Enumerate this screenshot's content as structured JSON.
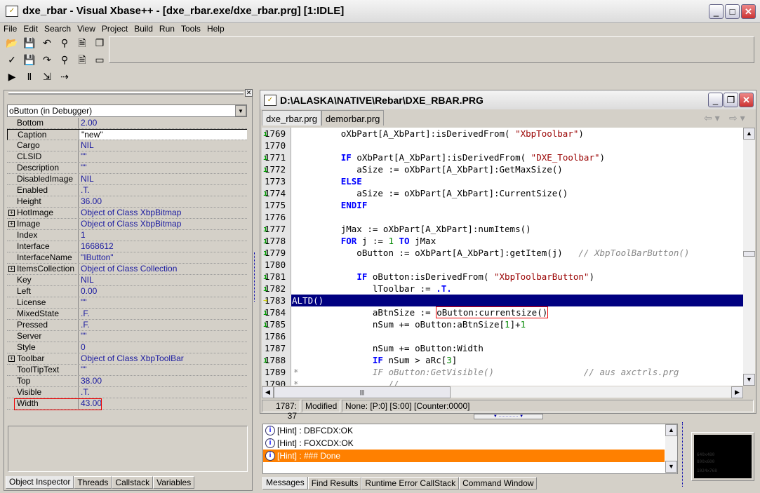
{
  "window": {
    "title": "dxe_rbar - Visual Xbase++ -  [dxe_rbar.exe/dxe_rbar.prg] [1:IDLE]",
    "controls": [
      "_",
      "□",
      "✕"
    ]
  },
  "menu": [
    "File",
    "Edit",
    "Search",
    "View",
    "Project",
    "Build",
    "Run",
    "Tools",
    "Help"
  ],
  "toolbar": {
    "rows": [
      [
        {
          "icon": "open-folder-icon",
          "glyph": "📂"
        },
        {
          "icon": "save-icon",
          "glyph": "💾"
        },
        {
          "icon": "undo-icon",
          "glyph": "↶"
        },
        {
          "icon": "find-icon",
          "glyph": "⚲"
        },
        {
          "icon": "new-file-icon",
          "glyph": "🗎"
        },
        {
          "icon": "windows-icon",
          "glyph": "❐"
        }
      ],
      [
        {
          "icon": "build-icon",
          "glyph": "✓"
        },
        {
          "icon": "save-all-icon",
          "glyph": "💾"
        },
        {
          "icon": "redo-icon",
          "glyph": "↷"
        },
        {
          "icon": "replace-icon",
          "glyph": "⚲"
        },
        {
          "icon": "close-file-icon",
          "glyph": "🗎"
        },
        {
          "icon": "output-window-icon",
          "glyph": "▭"
        }
      ],
      [
        {
          "icon": "run-stop-icon",
          "glyph": "▶"
        },
        {
          "icon": "pause-icon",
          "glyph": "Ⅱ"
        },
        {
          "icon": "step-into-icon",
          "glyph": "⇲"
        },
        {
          "icon": "step-over-icon",
          "glyph": "⇢"
        }
      ]
    ]
  },
  "inspector": {
    "object": "oButton (in Debugger)",
    "properties": [
      {
        "name": "Bottom",
        "value": "2.00"
      },
      {
        "name": "Caption",
        "value": "\"new\"",
        "selected": true
      },
      {
        "name": "Cargo",
        "value": "NIL"
      },
      {
        "name": "CLSID",
        "value": "\"\""
      },
      {
        "name": "Description",
        "value": "\"\""
      },
      {
        "name": "DisabledImage",
        "value": "NIL"
      },
      {
        "name": "Enabled",
        "value": ".T."
      },
      {
        "name": "Height",
        "value": "36.00"
      },
      {
        "name": "HotImage",
        "value": "Object of Class XbpBitmap",
        "expandable": true
      },
      {
        "name": "Image",
        "value": "Object of Class XbpBitmap",
        "expandable": true
      },
      {
        "name": "Index",
        "value": "1"
      },
      {
        "name": "Interface",
        "value": "1668612"
      },
      {
        "name": "InterfaceName",
        "value": "\"IButton\""
      },
      {
        "name": "ItemsCollection",
        "value": "Object of Class Collection",
        "expandable": true
      },
      {
        "name": "Key",
        "value": "NIL"
      },
      {
        "name": "Left",
        "value": "0.00"
      },
      {
        "name": "License",
        "value": "\"\""
      },
      {
        "name": "MixedState",
        "value": ".F."
      },
      {
        "name": "Pressed",
        "value": ".F."
      },
      {
        "name": "Server",
        "value": "\"\""
      },
      {
        "name": "Style",
        "value": "0"
      },
      {
        "name": "Toolbar",
        "value": "Object of Class XbpToolBar",
        "expandable": true
      },
      {
        "name": "ToolTipText",
        "value": "\"\""
      },
      {
        "name": "Top",
        "value": "38.00"
      },
      {
        "name": "Visible",
        "value": ".T."
      },
      {
        "name": "Width",
        "value": "43.00",
        "highlighted": true
      }
    ],
    "tabs": [
      "Object Inspector",
      "Threads",
      "Callstack",
      "Variables"
    ]
  },
  "editor": {
    "title": "D:\\ALASKA\\NATIVE\\Rebar\\DXE_RBAR.PRG",
    "file_tabs": [
      "dxe_rbar.prg",
      "demorbar.prg"
    ],
    "lines": [
      {
        "n": "1769",
        "m": true,
        "s": [
          [
            "         oXbPart[A_XbPart]:isDerivedFrom( ",
            ""
          ],
          [
            "\"XbpToolbar\"",
            "st"
          ],
          [
            ")",
            ""
          ]
        ]
      },
      {
        "n": "1770",
        "s": []
      },
      {
        "n": "1771",
        "m": true,
        "s": [
          [
            "         ",
            ""
          ],
          [
            "IF",
            "kw"
          ],
          [
            " oXbPart[A_XbPart]:isDerivedFrom( ",
            ""
          ],
          [
            "\"DXE_Toolbar\"",
            "st"
          ],
          [
            ")",
            ""
          ]
        ]
      },
      {
        "n": "1772",
        "m": true,
        "s": [
          [
            "            aSize := oXbPart[A_XbPart]:GetMaxSize()",
            ""
          ]
        ]
      },
      {
        "n": "1773",
        "s": [
          [
            "         ",
            ""
          ],
          [
            "ELSE",
            "kw"
          ]
        ]
      },
      {
        "n": "1774",
        "m": true,
        "s": [
          [
            "            aSize := oXbPart[A_XbPart]:CurrentSize()",
            ""
          ]
        ]
      },
      {
        "n": "1775",
        "s": [
          [
            "         ",
            ""
          ],
          [
            "ENDIF",
            "kw"
          ]
        ]
      },
      {
        "n": "1776",
        "s": []
      },
      {
        "n": "1777",
        "m": true,
        "s": [
          [
            "         jMax := oXbPart[A_XbPart]:numItems()",
            ""
          ]
        ]
      },
      {
        "n": "1778",
        "m": true,
        "s": [
          [
            "         ",
            ""
          ],
          [
            "FOR",
            "kw"
          ],
          [
            " j := ",
            ""
          ],
          [
            "1",
            "nm"
          ],
          [
            " ",
            ""
          ],
          [
            "TO",
            "kw"
          ],
          [
            " jMax",
            ""
          ]
        ]
      },
      {
        "n": "1779",
        "m": true,
        "s": [
          [
            "            oButton := oXbPart[A_XbPart]:getItem(j)   ",
            ""
          ],
          [
            "// XbpToolBarButton()",
            "cm"
          ]
        ]
      },
      {
        "n": "1780",
        "s": []
      },
      {
        "n": "1781",
        "m": true,
        "s": [
          [
            "            ",
            ""
          ],
          [
            "IF",
            "kw"
          ],
          [
            " oButton:isDerivedFrom( ",
            ""
          ],
          [
            "\"XbpToolbarButton\"",
            "st"
          ],
          [
            ")",
            ""
          ]
        ]
      },
      {
        "n": "1782",
        "m": true,
        "s": [
          [
            "               lToolbar := ",
            ""
          ],
          [
            ".T.",
            "kw"
          ]
        ]
      },
      {
        "n": "1783",
        "m": true,
        "current": true,
        "s": [
          [
            "ALTD()",
            ""
          ]
        ]
      },
      {
        "n": "1784",
        "m": true,
        "s": [
          [
            "               aBtnSize := ",
            ""
          ],
          [
            "oButton:currentsize()",
            "box"
          ]
        ]
      },
      {
        "n": "1785",
        "m": true,
        "s": [
          [
            "               nSum += oButton:aBtnSize[",
            ""
          ],
          [
            "1",
            "nm"
          ],
          [
            "]+",
            ""
          ],
          [
            "1",
            "nm"
          ]
        ]
      },
      {
        "n": "1786",
        "s": []
      },
      {
        "n": "1787",
        "s": [
          [
            "               nSum += oButton:Width",
            ""
          ]
        ]
      },
      {
        "n": "1788",
        "m": true,
        "s": [
          [
            "               ",
            ""
          ],
          [
            "IF",
            "kw"
          ],
          [
            " nSum > aRc[",
            ""
          ],
          [
            "3",
            "nm"
          ],
          [
            "]",
            ""
          ]
        ]
      },
      {
        "n": "1789",
        "s": [
          [
            "*              IF oButton:GetVisible()                 // aus axctrls.prg",
            "cm"
          ]
        ]
      },
      {
        "n": "1790",
        "s": [
          [
            "*                 //",
            "cm"
          ]
        ]
      }
    ],
    "status": {
      "position": "1787: 37",
      "state": "Modified",
      "info": "None: [P:0] [S:00] [Counter:0000]"
    }
  },
  "messages": {
    "items": [
      {
        "text": "[Hint] : DBFCDX:OK"
      },
      {
        "text": "[Hint] : FOXCDX:OK"
      },
      {
        "text": "[Hint] : ### Done",
        "selected": true
      }
    ],
    "tabs": [
      "Messages",
      "Find Results",
      "Runtime Error CallStack",
      "Command Window"
    ]
  },
  "preview": {
    "labels": [
      "640x480",
      "800x600",
      "1024x768"
    ]
  },
  "colors": {
    "selection": "#ff8000",
    "current_line": "#000080",
    "highlight_box": "#ee0000"
  }
}
